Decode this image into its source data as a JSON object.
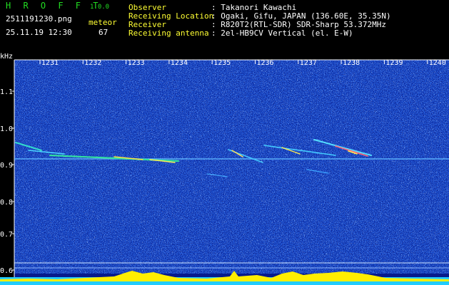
{
  "app": {
    "title": "H R O F F T",
    "version": "1.0.0"
  },
  "file": {
    "name": "2511191230.png",
    "datetime": "25.11.19 12:30"
  },
  "event": {
    "label": "meteor",
    "count": "67"
  },
  "info": [
    {
      "key": "Observer",
      "value": ": Takanori Kawachi"
    },
    {
      "key": "Receiving Location",
      "value": ": Ogaki, Gifu, JAPAN (136.60E, 35.35N)"
    },
    {
      "key": "Receiver",
      "value": ": R820T2(RTL-SDR) SDR-Sharp 53.372MHz"
    },
    {
      "key": "Receiving antenna",
      "value": ": 2el-HB9CV Vertical (el. E-W)"
    }
  ],
  "axis": {
    "y_unit": "kHz",
    "y_ticks": [
      "1.1",
      "1.0",
      "0.9",
      "0.8",
      "0.7",
      "0.6"
    ],
    "x_ticks": [
      "1231",
      "1232",
      "1233",
      "1234",
      "1235",
      "1236",
      "1237",
      "1238",
      "1239",
      "1240"
    ]
  },
  "colors": {
    "background": "#000000",
    "noise_base": "#0a18a0",
    "title_green": "#22dd22",
    "label_yellow": "#ffff33",
    "text_white": "#ffffff",
    "level_yellow": "#ffee00",
    "level_cyan": "#22ccff"
  }
}
